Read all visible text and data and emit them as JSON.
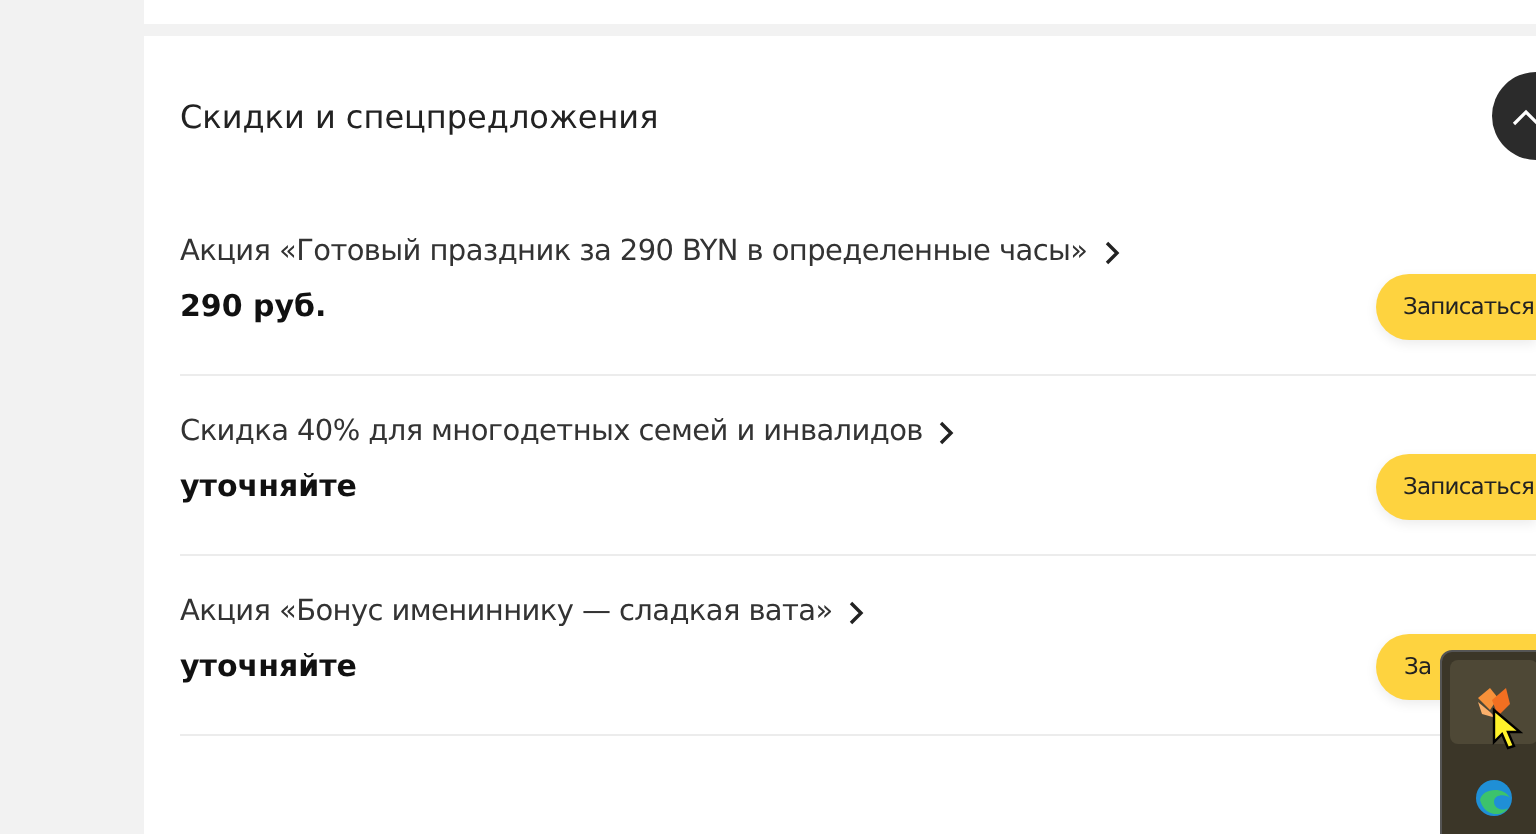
{
  "section": {
    "title": "Скидки и спецпредложения",
    "expanded": true
  },
  "offers": [
    {
      "title": "Акция «Готовый праздник за 290 BYN в определенные часы»",
      "price": "290 руб.",
      "button": "Записаться"
    },
    {
      "title": "Скидка 40% для многодетных семей и инвалидов",
      "price": "уточняйте",
      "button": "Записаться"
    },
    {
      "title": "Акция «Бонус имениннику — сладкая вата»",
      "price": "уточняйте",
      "button": "За"
    }
  ]
}
